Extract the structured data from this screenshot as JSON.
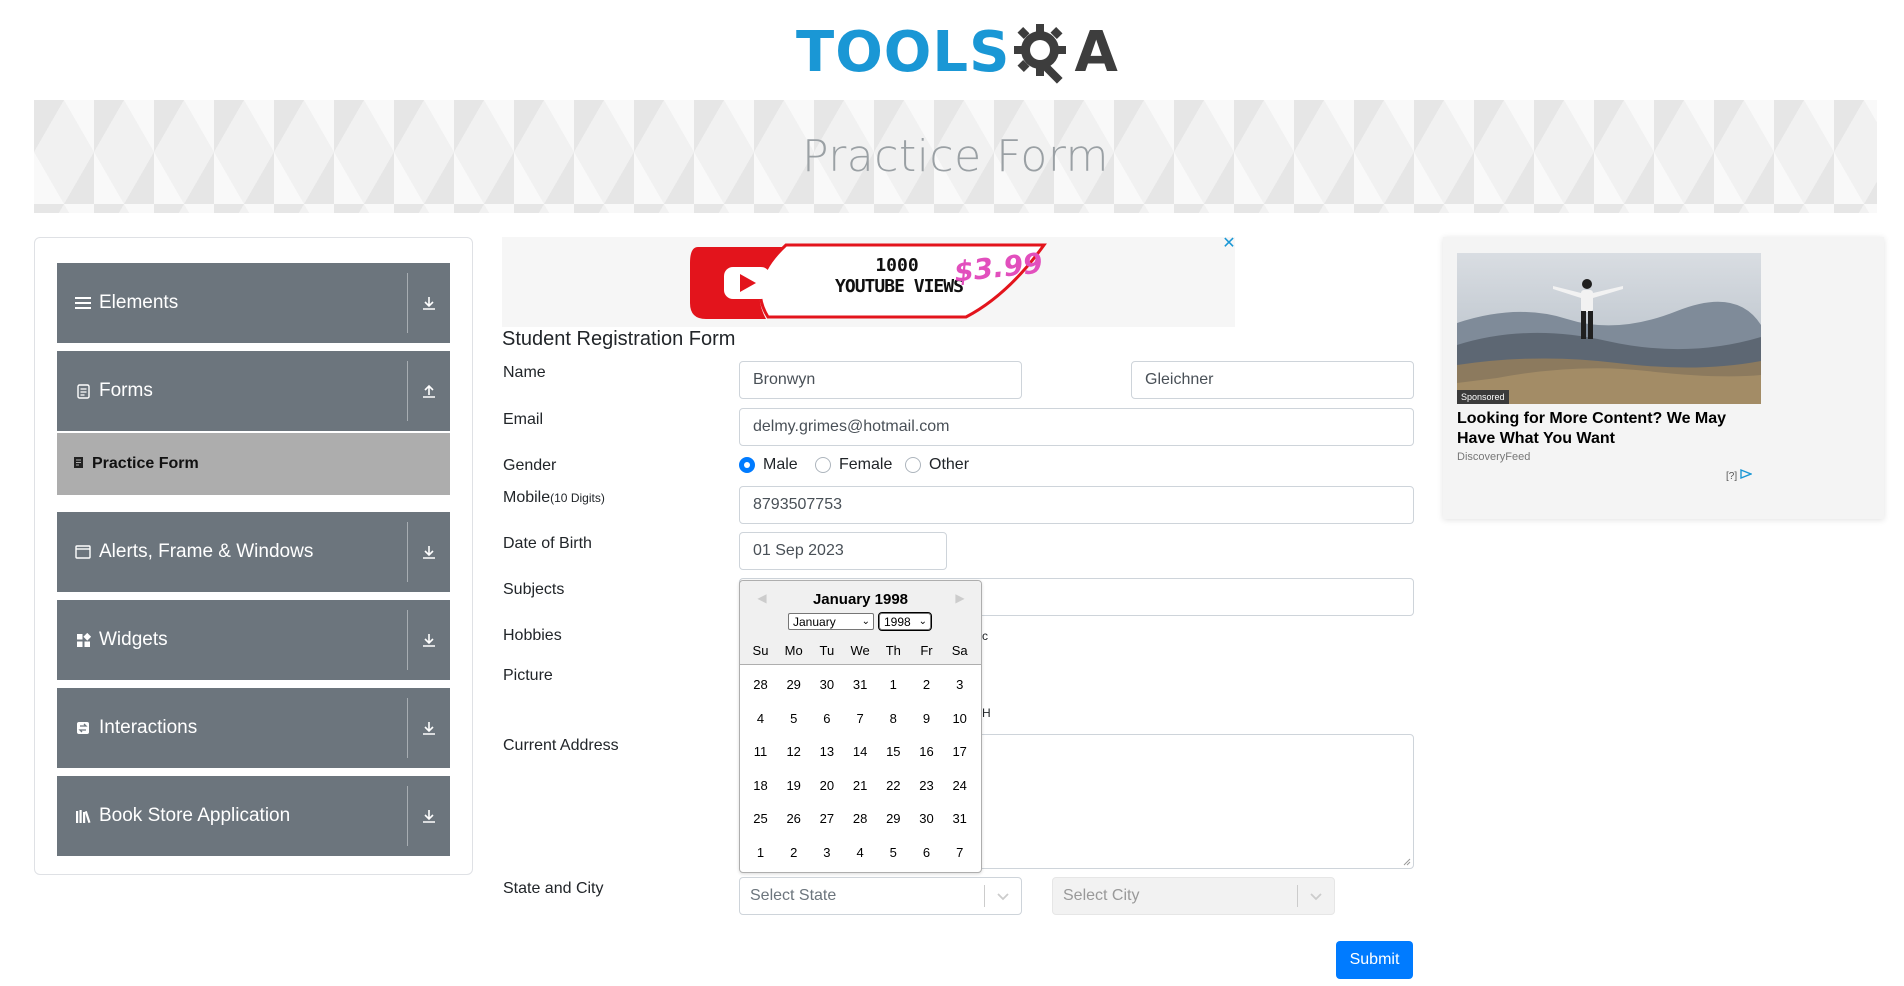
{
  "header": {
    "logo_text": "TOOLS",
    "logo_tail": "A",
    "banner_title": "Practice Form"
  },
  "sidebar": {
    "groups": [
      {
        "label": "Elements",
        "icon": "hamburger-icon",
        "arrow": "download-arrow-icon"
      },
      {
        "label": "Forms",
        "icon": "document-icon",
        "arrow": "upload-arrow-icon"
      },
      {
        "label": "Alerts, Frame & Windows",
        "icon": "window-icon",
        "arrow": "download-arrow-icon"
      },
      {
        "label": "Widgets",
        "icon": "widgets-icon",
        "arrow": "download-arrow-icon"
      },
      {
        "label": "Interactions",
        "icon": "interactions-icon",
        "arrow": "download-arrow-icon"
      },
      {
        "label": "Book Store Application",
        "icon": "books-icon",
        "arrow": "download-arrow-icon"
      }
    ],
    "active_item": {
      "label": "Practice Form",
      "icon": "file-icon"
    }
  },
  "ad_top": {
    "line1": "1000",
    "line2": "YOUTUBE VIEWS",
    "price": "$3.99",
    "close": "✕"
  },
  "form": {
    "title": "Student Registration Form",
    "name_label": "Name",
    "first_name": "Bronwyn",
    "last_name": "Gleichner",
    "email_label": "Email",
    "email": "delmy.grimes@hotmail.com",
    "gender_label": "Gender",
    "gender_options": [
      "Male",
      "Female",
      "Other"
    ],
    "gender_selected": "Male",
    "mobile_label": "Mobile",
    "mobile_hint": "(10 Digits)",
    "mobile": "8793507753",
    "dob_label": "Date of Birth",
    "dob": "01 Sep 2023",
    "subjects_label": "Subjects",
    "hobbies_label": "Hobbies",
    "hobbies_peek": "c",
    "picture_label": "Picture",
    "picture_peek": "H",
    "address_label": "Current Address",
    "state_city_label": "State and City",
    "state_placeholder": "Select State",
    "city_placeholder": "Select City",
    "submit": "Submit"
  },
  "datepicker": {
    "title": "January 1998",
    "month_select": "January",
    "year_select": "1998",
    "day_names": [
      "Su",
      "Mo",
      "Tu",
      "We",
      "Th",
      "Fr",
      "Sa"
    ],
    "weeks": [
      [
        "28",
        "29",
        "30",
        "31",
        "1",
        "2",
        "3"
      ],
      [
        "4",
        "5",
        "6",
        "7",
        "8",
        "9",
        "10"
      ],
      [
        "11",
        "12",
        "13",
        "14",
        "15",
        "16",
        "17"
      ],
      [
        "18",
        "19",
        "20",
        "21",
        "22",
        "23",
        "24"
      ],
      [
        "25",
        "26",
        "27",
        "28",
        "29",
        "30",
        "31"
      ],
      [
        "1",
        "2",
        "3",
        "4",
        "5",
        "6",
        "7"
      ]
    ]
  },
  "ad_right": {
    "badge": "Sponsored",
    "headline": "Looking for More Content? We May Have What You Want",
    "source": "DiscoveryFeed",
    "info": "[?]"
  }
}
